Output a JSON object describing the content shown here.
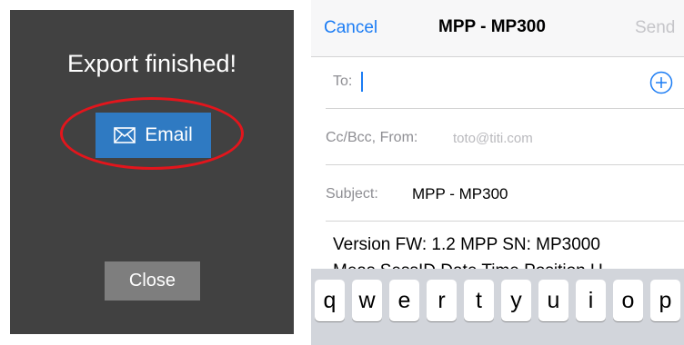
{
  "export_dialog": {
    "title": "Export finished!",
    "email_label": "Email",
    "close_label": "Close",
    "colors": {
      "background": "#414141",
      "email_button": "#2f7ac2",
      "highlight": "#e3151c",
      "close_button": "#7e7e7e"
    }
  },
  "compose": {
    "nav": {
      "cancel_label": "Cancel",
      "title": "MPP - MP300",
      "send_label": "Send"
    },
    "to_label": "To:",
    "cc_label": "Cc/Bcc, From:",
    "from_value": "toto@titi.com",
    "subject_label": "Subject:",
    "subject_value": "MPP - MP300",
    "body_line1": "Version FW: 1.2 MPP SN: MP3000",
    "body_line2": "Meas SessID Date Time Position U",
    "keyboard_keys": [
      "q",
      "w",
      "e",
      "r",
      "t",
      "y",
      "u",
      "i",
      "o",
      "p"
    ],
    "colors": {
      "accent": "#1b7cf4",
      "keyboard": "#d2d5db"
    }
  }
}
